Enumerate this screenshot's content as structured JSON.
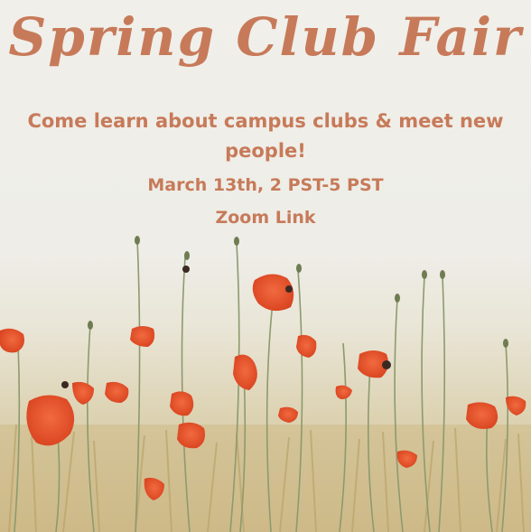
{
  "poster": {
    "title": "Spring Club Fair",
    "subtitle": "Come learn about campus clubs & meet new people!",
    "date": "March 13th, 2 PST-5 PST",
    "link_label": "Zoom Link"
  },
  "colors": {
    "text": "#c77a59",
    "poppy": "#e8542e",
    "stem": "#8a9a6a",
    "grass": "#c9b57e"
  },
  "background": "poppy-and-wheat-field-photo"
}
